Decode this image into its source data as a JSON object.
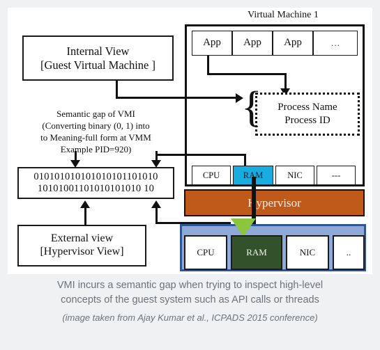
{
  "figure": {
    "title": "Virtual Machine 1",
    "internal_view": {
      "line1": "Internal View",
      "line2": "[Guest Virtual Machine ]"
    },
    "semantic_gap_note": {
      "line1": "Semantic gap of VMI",
      "line2": "(Converting binary  (0, 1) into",
      "line3": "to Meaning-full form at VMM",
      "line4": "Example PID=920)"
    },
    "binary_box": {
      "line1": "010101010101010101101010",
      "line2": "10101001101010101010 10"
    },
    "external_view": {
      "line1": "External view",
      "line2": "[Hypervisor View]"
    },
    "apps": [
      "App",
      "App",
      "App",
      "…"
    ],
    "process_box": {
      "line1": "Process Name",
      "line2": "Process ID"
    },
    "guest_hardware": [
      "CPU",
      "RAM",
      "NIC",
      "---"
    ],
    "hypervisor_label": "Hypervisor",
    "host_hardware": [
      "CPU",
      "RAM",
      "NIC",
      ".."
    ],
    "colors": {
      "guest_ram": "#18ace0",
      "hypervisor": "#c05a1a",
      "hypervisor_text": "#f6efe6",
      "trapezoid": "#8cc63f",
      "host_ram": "#33512b",
      "host_band": "#8fa9d8",
      "host_band_border": "#2f5597",
      "outline": "#1a1a1a"
    }
  },
  "caption": {
    "line1": "VMI incurs a semantic gap when trying to inspect high-level",
    "line2": "concepts of the guest system such as API calls or threads",
    "credit": "(image taken from Ajay Kumar et al., ICPADS 2015 conference)"
  }
}
